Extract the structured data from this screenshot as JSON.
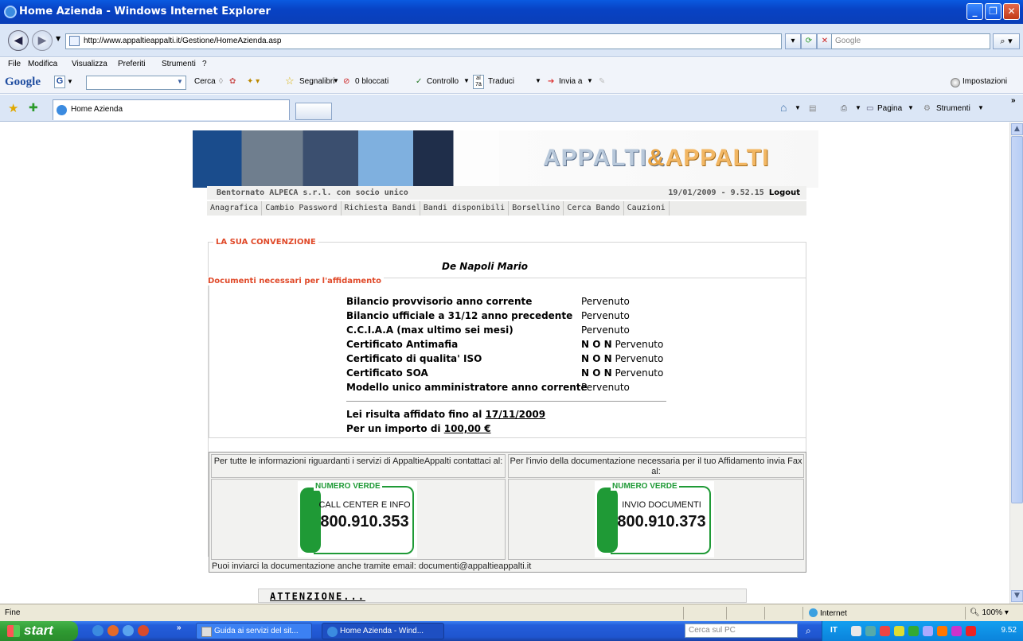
{
  "window": {
    "title": "Home Azienda - Windows Internet Explorer",
    "url": "http://www.appaltieappalti.it/Gestione/HomeAzienda.asp",
    "search_placeholder": "Google"
  },
  "menu": [
    "File",
    "Modifica",
    "Visualizza",
    "Preferiti",
    "Strumenti",
    "?"
  ],
  "google_toolbar": {
    "logo": "Google",
    "items": [
      "Cerca",
      "Segnalibri",
      "0 bloccati",
      "Controllo",
      "Traduci",
      "Invia a",
      "Impostazioni"
    ]
  },
  "tabs": {
    "active": "Home Azienda",
    "right_items": [
      "Pagina",
      "Strumenti"
    ]
  },
  "page": {
    "banner_logo_left": "APPALTI",
    "banner_logo_amp": "&",
    "banner_logo_right": "APPALTI",
    "welcome": "Bentornato ALPECA s.r.l. con socio unico",
    "datetime": "19/01/2009 - 9.52.15",
    "logout": "Logout",
    "nav": [
      "Anagrafica",
      "Cambio Password",
      "Richiesta Bandi",
      "Bandi disponibili",
      "Borsellino",
      "Cerca Bando",
      "Cauzioni"
    ],
    "convention_legend": "LA SUA CONVENZIONE",
    "convention_name": "De Napoli Mario",
    "docs_legend": "Documenti necessari per l'affidamento",
    "documents": [
      {
        "name": "Bilancio provvisorio anno corrente",
        "status_prefix": "",
        "status": "Pervenuto"
      },
      {
        "name": "Bilancio ufficiale a 31/12 anno precedente",
        "status_prefix": "",
        "status": "Pervenuto"
      },
      {
        "name": "C.C.I.A.A (max ultimo sei mesi)",
        "status_prefix": "",
        "status": "Pervenuto"
      },
      {
        "name": "Certificato Antimafia",
        "status_prefix": "N O N",
        "status": "Pervenuto"
      },
      {
        "name": "Certificato di qualita' ISO",
        "status_prefix": "N O N",
        "status": "Pervenuto"
      },
      {
        "name": "Certificato SOA",
        "status_prefix": "N O N",
        "status": "Pervenuto"
      },
      {
        "name": "Modello unico amministratore anno corrente",
        "status_prefix": "",
        "status": "Pervenuto"
      }
    ],
    "affidato_label": "Lei risulta affidato fino al",
    "affidato_date": "17/11/2009",
    "importo_label": "Per un importo di",
    "importo_value": "100,00 €",
    "contact_left_text": "Per tutte le informazioni riguardanti i servizi di AppaltieAppalti contattaci al:",
    "contact_right_text": "Per l'invio della documentazione necessaria per il tuo Affidamento invia Fax al:",
    "numero_verde_label": "NUMERO VERDE",
    "left_service": "CALL CENTER E INFO",
    "left_number": "800.910.353",
    "right_service": "INVIO DOCUMENTI",
    "right_number": "800.910.373",
    "email_line": "Puoi inviarci la documentazione anche tramite email: documenti@appaltieappalti.it",
    "attention": "ATTENZIONE..."
  },
  "statusbar": {
    "left": "Fine",
    "zone": "Internet",
    "zoom": "100%"
  },
  "taskbar": {
    "start": "start",
    "buttons": [
      "Guida ai servizi del sit...",
      "Home Azienda - Wind..."
    ],
    "search_placeholder": "Cerca sul PC",
    "language": "IT",
    "clock": "9.52"
  },
  "colors": {
    "legend_red": "#e04a2a",
    "numero_verde_green": "#1f9a36",
    "xp_blue": "#245edb"
  }
}
